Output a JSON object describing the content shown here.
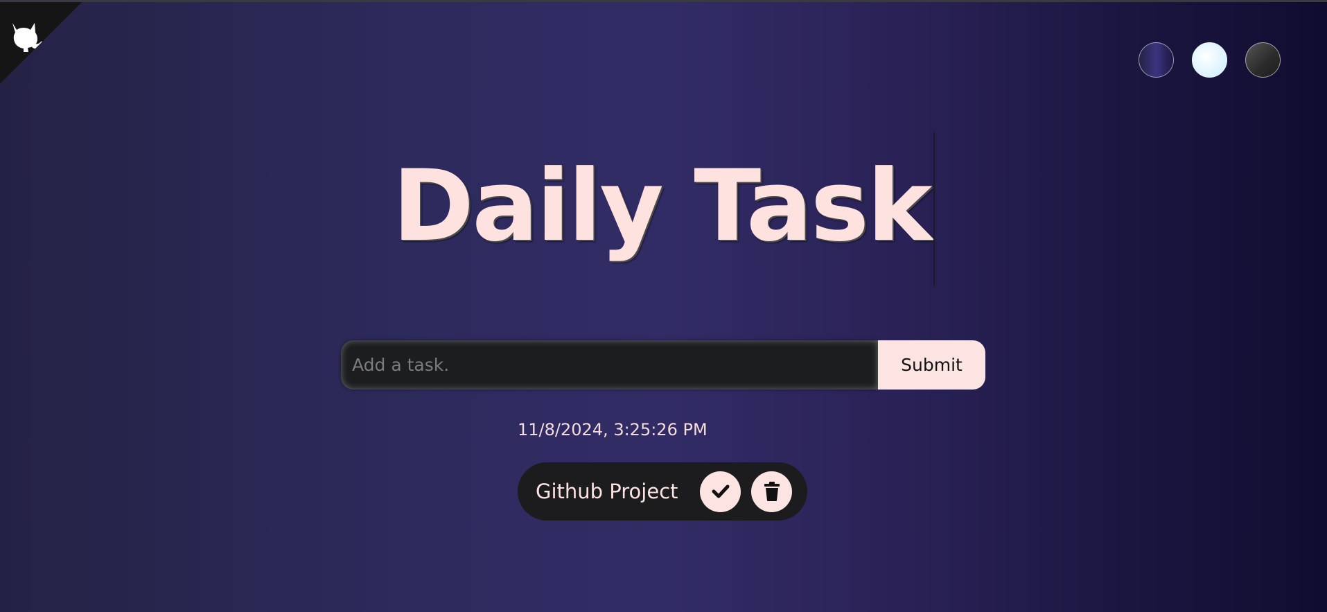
{
  "corner": {
    "icon": "github-octocat-icon"
  },
  "themes": [
    {
      "name": "standard",
      "color": "#2d2a5c"
    },
    {
      "name": "light",
      "color": "#e6f6ff"
    },
    {
      "name": "darker",
      "color": "#2a2a2a"
    }
  ],
  "header": {
    "title": "Daily Task"
  },
  "form": {
    "placeholder": "Add a task.",
    "value": "",
    "submit_label": "Submit"
  },
  "datetime": "11/8/2024, 3:25:26 PM",
  "tasks": [
    {
      "text": "Github Project",
      "complete_icon": "check-icon",
      "delete_icon": "trash-icon"
    }
  ],
  "colors": {
    "accent": "#fbe4e2",
    "dark": "#1c1c1e"
  }
}
